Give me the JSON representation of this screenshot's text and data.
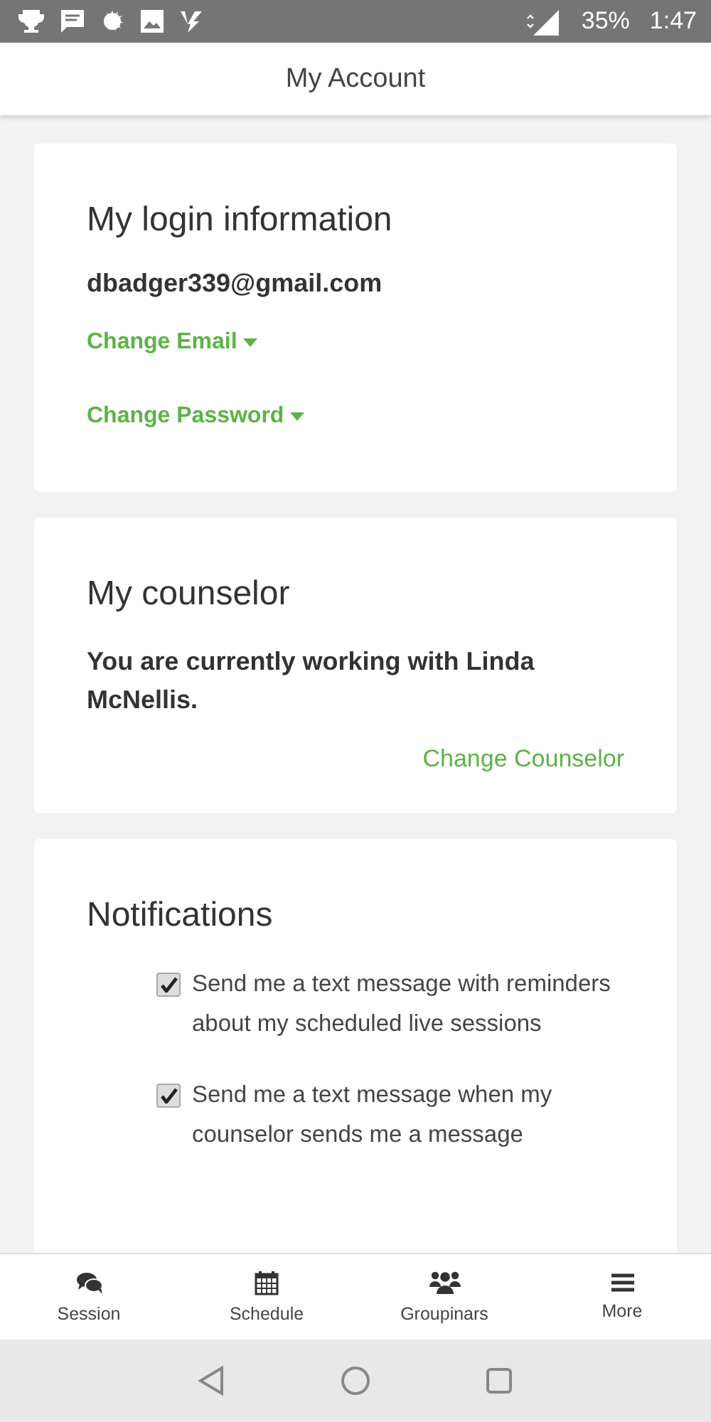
{
  "status_bar": {
    "battery": "35%",
    "time": "1:47"
  },
  "header": {
    "title": "My Account"
  },
  "login": {
    "title": "My login information",
    "email": "dbadger339@gmail.com",
    "links": [
      "Change Email",
      "Change Password"
    ]
  },
  "counselor": {
    "title": "My counselor",
    "text": "You are currently working with Linda McNellis.",
    "link": "Change Counselor"
  },
  "notifications": {
    "title": "Notifications",
    "options": [
      {
        "label": "Send me a text message with reminders about my scheduled live sessions",
        "checked": true
      },
      {
        "label": "Send me a text message when my counselor sends me a message",
        "checked": true
      }
    ]
  },
  "bottom_nav": [
    {
      "label": "Session",
      "kind": "chat"
    },
    {
      "label": "Schedule",
      "kind": "calendar"
    },
    {
      "label": "Groupinars",
      "kind": "group"
    },
    {
      "label": "More",
      "kind": "menu"
    }
  ]
}
